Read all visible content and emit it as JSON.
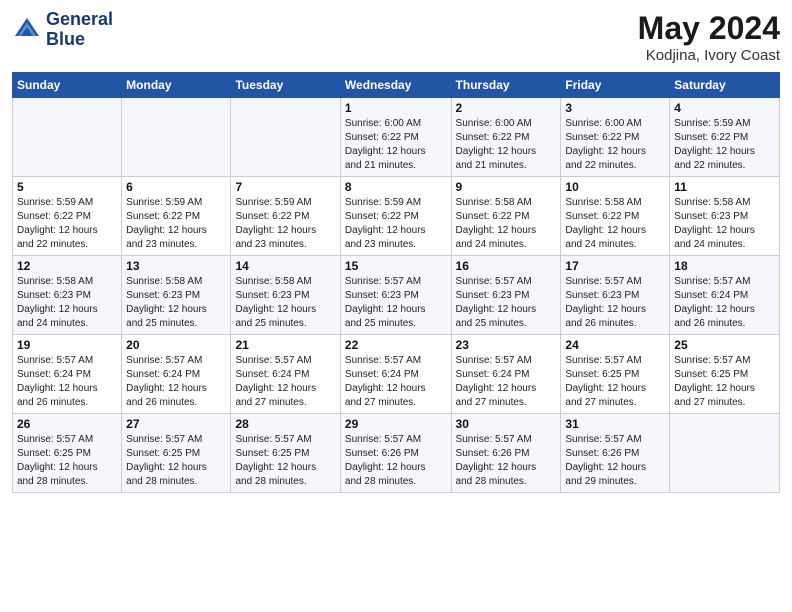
{
  "header": {
    "logo_line1": "General",
    "logo_line2": "Blue",
    "month_year": "May 2024",
    "location": "Kodjina, Ivory Coast"
  },
  "weekdays": [
    "Sunday",
    "Monday",
    "Tuesday",
    "Wednesday",
    "Thursday",
    "Friday",
    "Saturday"
  ],
  "weeks": [
    [
      {
        "day": "",
        "info": ""
      },
      {
        "day": "",
        "info": ""
      },
      {
        "day": "",
        "info": ""
      },
      {
        "day": "1",
        "info": "Sunrise: 6:00 AM\nSunset: 6:22 PM\nDaylight: 12 hours\nand 21 minutes."
      },
      {
        "day": "2",
        "info": "Sunrise: 6:00 AM\nSunset: 6:22 PM\nDaylight: 12 hours\nand 21 minutes."
      },
      {
        "day": "3",
        "info": "Sunrise: 6:00 AM\nSunset: 6:22 PM\nDaylight: 12 hours\nand 22 minutes."
      },
      {
        "day": "4",
        "info": "Sunrise: 5:59 AM\nSunset: 6:22 PM\nDaylight: 12 hours\nand 22 minutes."
      }
    ],
    [
      {
        "day": "5",
        "info": "Sunrise: 5:59 AM\nSunset: 6:22 PM\nDaylight: 12 hours\nand 22 minutes."
      },
      {
        "day": "6",
        "info": "Sunrise: 5:59 AM\nSunset: 6:22 PM\nDaylight: 12 hours\nand 23 minutes."
      },
      {
        "day": "7",
        "info": "Sunrise: 5:59 AM\nSunset: 6:22 PM\nDaylight: 12 hours\nand 23 minutes."
      },
      {
        "day": "8",
        "info": "Sunrise: 5:59 AM\nSunset: 6:22 PM\nDaylight: 12 hours\nand 23 minutes."
      },
      {
        "day": "9",
        "info": "Sunrise: 5:58 AM\nSunset: 6:22 PM\nDaylight: 12 hours\nand 24 minutes."
      },
      {
        "day": "10",
        "info": "Sunrise: 5:58 AM\nSunset: 6:22 PM\nDaylight: 12 hours\nand 24 minutes."
      },
      {
        "day": "11",
        "info": "Sunrise: 5:58 AM\nSunset: 6:23 PM\nDaylight: 12 hours\nand 24 minutes."
      }
    ],
    [
      {
        "day": "12",
        "info": "Sunrise: 5:58 AM\nSunset: 6:23 PM\nDaylight: 12 hours\nand 24 minutes."
      },
      {
        "day": "13",
        "info": "Sunrise: 5:58 AM\nSunset: 6:23 PM\nDaylight: 12 hours\nand 25 minutes."
      },
      {
        "day": "14",
        "info": "Sunrise: 5:58 AM\nSunset: 6:23 PM\nDaylight: 12 hours\nand 25 minutes."
      },
      {
        "day": "15",
        "info": "Sunrise: 5:57 AM\nSunset: 6:23 PM\nDaylight: 12 hours\nand 25 minutes."
      },
      {
        "day": "16",
        "info": "Sunrise: 5:57 AM\nSunset: 6:23 PM\nDaylight: 12 hours\nand 25 minutes."
      },
      {
        "day": "17",
        "info": "Sunrise: 5:57 AM\nSunset: 6:23 PM\nDaylight: 12 hours\nand 26 minutes."
      },
      {
        "day": "18",
        "info": "Sunrise: 5:57 AM\nSunset: 6:24 PM\nDaylight: 12 hours\nand 26 minutes."
      }
    ],
    [
      {
        "day": "19",
        "info": "Sunrise: 5:57 AM\nSunset: 6:24 PM\nDaylight: 12 hours\nand 26 minutes."
      },
      {
        "day": "20",
        "info": "Sunrise: 5:57 AM\nSunset: 6:24 PM\nDaylight: 12 hours\nand 26 minutes."
      },
      {
        "day": "21",
        "info": "Sunrise: 5:57 AM\nSunset: 6:24 PM\nDaylight: 12 hours\nand 27 minutes."
      },
      {
        "day": "22",
        "info": "Sunrise: 5:57 AM\nSunset: 6:24 PM\nDaylight: 12 hours\nand 27 minutes."
      },
      {
        "day": "23",
        "info": "Sunrise: 5:57 AM\nSunset: 6:24 PM\nDaylight: 12 hours\nand 27 minutes."
      },
      {
        "day": "24",
        "info": "Sunrise: 5:57 AM\nSunset: 6:25 PM\nDaylight: 12 hours\nand 27 minutes."
      },
      {
        "day": "25",
        "info": "Sunrise: 5:57 AM\nSunset: 6:25 PM\nDaylight: 12 hours\nand 27 minutes."
      }
    ],
    [
      {
        "day": "26",
        "info": "Sunrise: 5:57 AM\nSunset: 6:25 PM\nDaylight: 12 hours\nand 28 minutes."
      },
      {
        "day": "27",
        "info": "Sunrise: 5:57 AM\nSunset: 6:25 PM\nDaylight: 12 hours\nand 28 minutes."
      },
      {
        "day": "28",
        "info": "Sunrise: 5:57 AM\nSunset: 6:25 PM\nDaylight: 12 hours\nand 28 minutes."
      },
      {
        "day": "29",
        "info": "Sunrise: 5:57 AM\nSunset: 6:26 PM\nDaylight: 12 hours\nand 28 minutes."
      },
      {
        "day": "30",
        "info": "Sunrise: 5:57 AM\nSunset: 6:26 PM\nDaylight: 12 hours\nand 28 minutes."
      },
      {
        "day": "31",
        "info": "Sunrise: 5:57 AM\nSunset: 6:26 PM\nDaylight: 12 hours\nand 29 minutes."
      },
      {
        "day": "",
        "info": ""
      }
    ]
  ]
}
